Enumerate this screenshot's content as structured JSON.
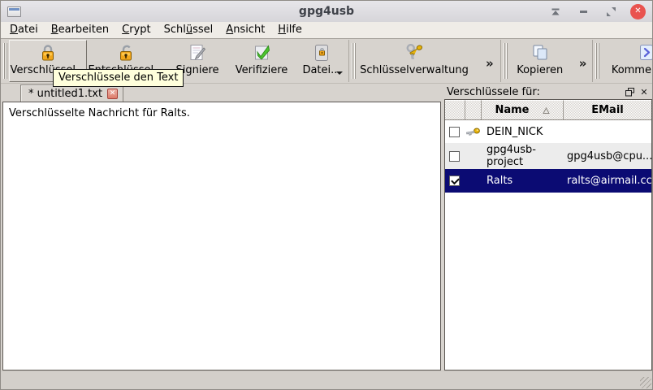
{
  "window": {
    "title": "gpg4usb"
  },
  "menubar": {
    "items": [
      {
        "pre": "",
        "key": "D",
        "post": "atei"
      },
      {
        "pre": "",
        "key": "B",
        "post": "earbeiten"
      },
      {
        "pre": "",
        "key": "C",
        "post": "rypt"
      },
      {
        "pre": "Schl",
        "key": "ü",
        "post": "ssel"
      },
      {
        "pre": "",
        "key": "A",
        "post": "nsicht"
      },
      {
        "pre": "",
        "key": "H",
        "post": "ilfe"
      }
    ]
  },
  "toolbar": {
    "encrypt_label": "Verschlüssel...",
    "decrypt_label": "Entschlüssel...",
    "sign_label": "Signiere",
    "verify_label": "Verifiziere",
    "file_label": "Datei...",
    "key_management_label": "Schlüsselverwaltung",
    "copy_label": "Kopieren",
    "comment_label": "Kommentiere",
    "overflow_indicator": "»"
  },
  "tooltip": {
    "text": "Verschlüssele den Text"
  },
  "tabbar": {
    "active_tab_title": "* untitled1.txt"
  },
  "editor": {
    "text": "Verschlüsselte Nachricht für Ralts."
  },
  "dock": {
    "title": "Verschlüssele für:",
    "table": {
      "columns": {
        "name": "Name",
        "email": "EMail"
      },
      "rows": [
        {
          "name": "DEIN_NICK",
          "email": "",
          "checked": false,
          "selected": false,
          "has_key_icon": true
        },
        {
          "name": "gpg4usb-project",
          "email": "gpg4usb@cpu...",
          "checked": false,
          "selected": false,
          "has_key_icon": false
        },
        {
          "name": "Ralts",
          "email": "ralts@airmail.cc",
          "checked": true,
          "selected": true,
          "has_key_icon": false
        }
      ]
    }
  },
  "colors": {
    "selection_bg": "#0b0b73",
    "tooltip_bg": "#ffffdc",
    "close_button_red": "#e9534f",
    "padlock_gold": "#f0a500"
  }
}
